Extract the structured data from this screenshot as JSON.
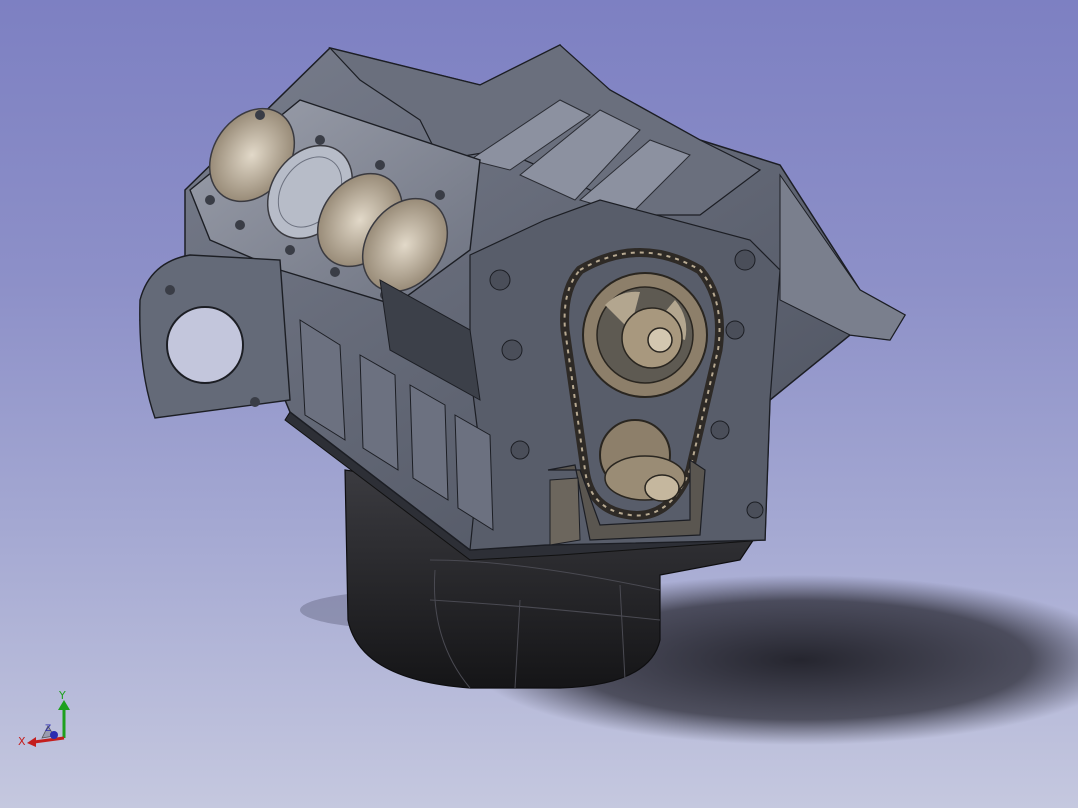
{
  "viewport": {
    "background_top": "#7d80c2",
    "background_bottom": "#c5c8df",
    "model_color": "#5b6170",
    "oil_pan_color": "#222226",
    "chain_color": "#3a3530",
    "gear_color": "#9a8a72"
  },
  "triad": {
    "x_label": "X",
    "y_label": "Y",
    "z_label": "Z",
    "x_color": "#c41e1e",
    "y_color": "#1ea01e",
    "z_color": "#2b2bb0"
  }
}
